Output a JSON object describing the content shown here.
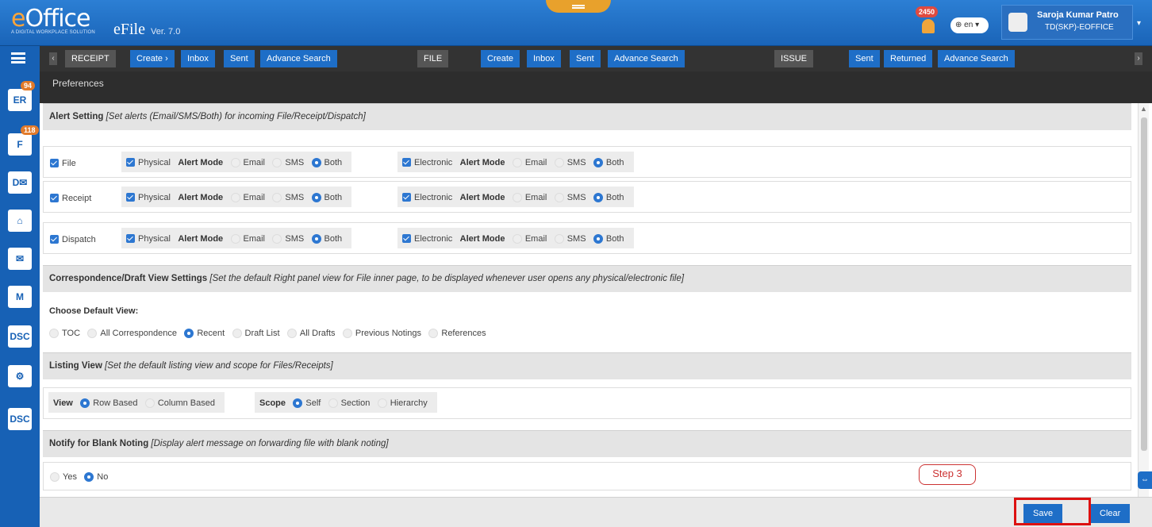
{
  "header": {
    "brand": "eOffice",
    "tagline": "A DIGITAL WORKPLACE SOLUTION",
    "app": "eFile",
    "version": "Ver. 7.0",
    "notifications": "2450",
    "language": "en",
    "user_name": "Saroja Kumar Patro",
    "user_dept": "TD(SKP)-EOFFICE"
  },
  "sidebar": {
    "items": [
      {
        "icon": "receipt-icon",
        "badge": "94"
      },
      {
        "icon": "file-icon",
        "badge": "118"
      },
      {
        "icon": "dispatch-icon"
      },
      {
        "icon": "home-icon"
      },
      {
        "icon": "mail-icon"
      },
      {
        "icon": "move-icon"
      },
      {
        "icon": "dsc-icon"
      },
      {
        "icon": "settings-person-icon"
      },
      {
        "icon": "dsc-icon"
      }
    ]
  },
  "navbar": {
    "receipt": {
      "label": "RECEIPT",
      "items": [
        "Create ›",
        "Inbox",
        "Sent",
        "Advance Search"
      ]
    },
    "file": {
      "label": "FILE",
      "items": [
        "Create",
        "Inbox",
        "Sent",
        "Advance Search"
      ]
    },
    "issue": {
      "label": "ISSUE",
      "items": [
        "Sent",
        "Returned",
        "Advance Search"
      ]
    }
  },
  "page_title": "Preferences",
  "alert_setting": {
    "title": "Alert Setting",
    "desc": "[Set alerts (Email/SMS/Both) for incoming File/Receipt/Dispatch]",
    "alert_mode_label": "Alert Mode",
    "physical_label": "Physical",
    "electronic_label": "Electronic",
    "email": "Email",
    "sms": "SMS",
    "both": "Both",
    "rows": [
      "File",
      "Receipt",
      "Dispatch"
    ]
  },
  "correspondence": {
    "title": "Correspondence/Draft View Settings",
    "desc": "[Set the default Right panel view for File inner page, to be displayed whenever user opens any physical/electronic file]",
    "choose_label": "Choose Default View:",
    "options": [
      "TOC",
      "All Correspondence",
      "Recent",
      "Draft List",
      "All Drafts",
      "Previous Notings",
      "References"
    ],
    "selected": "Recent"
  },
  "listing": {
    "title": "Listing View",
    "desc": "[Set the default listing view and scope for Files/Receipts]",
    "view_label": "View",
    "view_options": [
      "Row Based",
      "Column Based"
    ],
    "scope_label": "Scope",
    "scope_options": [
      "Self",
      "Section",
      "Hierarchy"
    ]
  },
  "blank_noting": {
    "title": "Notify for Blank Noting",
    "desc": "[Display alert message on forwarding file with blank noting]",
    "options": [
      "Yes",
      "No"
    ]
  },
  "annotation": {
    "step": "Step 3"
  },
  "buttons": {
    "save": "Save",
    "clear": "Clear"
  }
}
